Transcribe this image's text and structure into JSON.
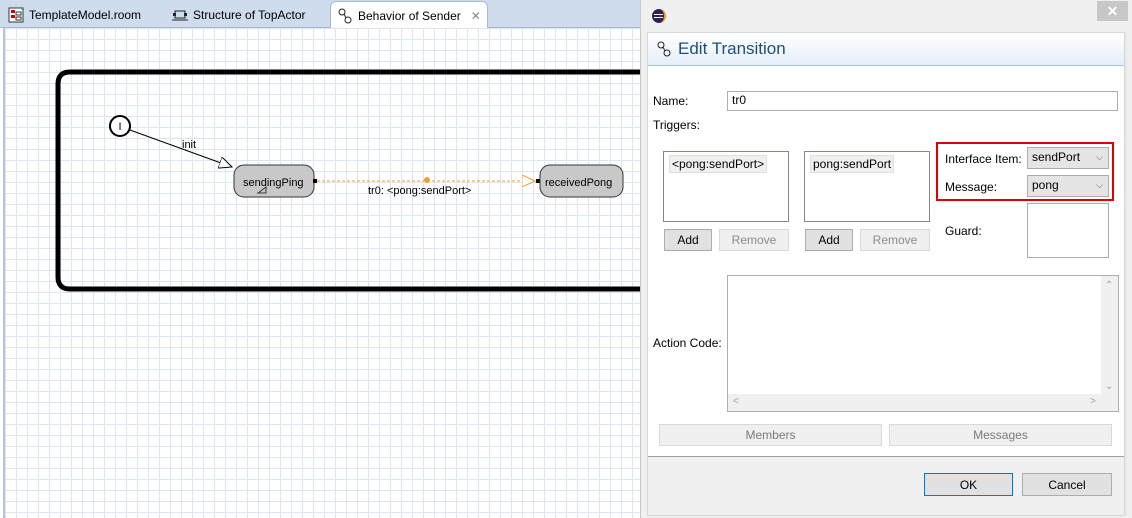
{
  "tabs": [
    {
      "label": "TemplateModel.room",
      "icon": "room-model-icon",
      "active": false
    },
    {
      "label": "Structure of TopActor",
      "icon": "structure-icon",
      "active": false
    },
    {
      "label": "Behavior of Sender",
      "icon": "behavior-icon",
      "active": true,
      "close": "✕"
    }
  ],
  "diagram": {
    "initial_label": "I",
    "init_transition_label": "init",
    "states": [
      {
        "name": "sendingPing"
      },
      {
        "name": "receivedPong"
      }
    ],
    "transition_label": "tr0: <pong:sendPort>",
    "colors": {
      "state_fill": "#c8c8c8",
      "selected_transition": "#f0a030",
      "frame": "#000000"
    }
  },
  "dialog": {
    "close_label": "✕",
    "title": "Edit Transition",
    "name_label": "Name:",
    "name_value": "tr0",
    "triggers_label": "Triggers:",
    "trigger_list": [
      "<pong:sendPort>"
    ],
    "trigger_add": "Add",
    "trigger_remove": "Remove",
    "msg_list": [
      "pong:sendPort"
    ],
    "msg_add": "Add",
    "msg_remove": "Remove",
    "interface_item_label": "Interface Item:",
    "interface_item_value": "sendPort",
    "message_label": "Message:",
    "message_value": "pong",
    "guard_label": "Guard:",
    "guard_value": "",
    "action_code_label": "Action Code:",
    "action_code_value": "",
    "members_button": "Members",
    "messages_button": "Messages",
    "ok_button": "OK",
    "cancel_button": "Cancel",
    "highlight_color": "#e00000"
  }
}
